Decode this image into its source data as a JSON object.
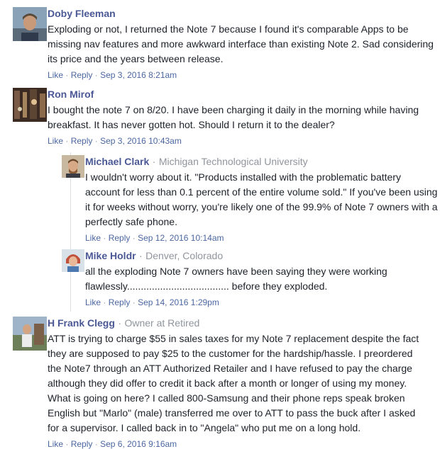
{
  "separator": "·",
  "comments": [
    {
      "author": "Doby Fleeman",
      "affiliation": "",
      "text": "Exploding or not, I returned the Note 7 because I found it's comparable Apps to be missing nav features and more awkward interface than existing Note 2. Sad considering its price and the years between release.",
      "like": "Like",
      "reply": "Reply",
      "date": "Sep 3, 2016 8:21am"
    },
    {
      "author": "Ron Mirof",
      "affiliation": "",
      "text": "I bought the note 7 on 8/20. I have been charging it daily in the morning while having breakfast. It has never gotten hot. Should I return it to the dealer?",
      "like": "Like",
      "reply": "Reply",
      "date": "Sep 3, 2016 10:43am",
      "replies": [
        {
          "author": "Michael Clark",
          "affiliation": "Michigan Technological University",
          "text": "I wouldn't worry about it. \"Products installed with the problematic battery account for less than 0.1 percent of the entire volume sold.\" If you've been using it for weeks without worry, you're likely one of the 99.9% of Note 7 owners with a perfectly safe phone.",
          "like": "Like",
          "reply": "Reply",
          "date": "Sep 12, 2016 10:14am"
        },
        {
          "author": "Mike Holdr",
          "affiliation": "Denver, Colorado",
          "text": "all the exploding Note 7 owners have been saying they were working flawlessly..................................... before they exploded.",
          "like": "Like",
          "reply": "Reply",
          "date": "Sep 14, 2016 1:29pm"
        }
      ]
    },
    {
      "author": "H Frank Clegg",
      "affiliation": "Owner at Retired",
      "text": "ATT is trying to charge $55 in sales taxes for my Note 7 replacement despite the fact they are supposed to pay $25 to the customer for the hardship/hassle. I preordered the Note7 through an ATT Authorized Retailer and I have refused to pay the charge although they did offer to credit it back after a month or longer of using my money. What is going on here? I called 800-Samsung and their phone reps speak broken English but \"Marlo\" (male) transferred me over to ATT to pass the buck after I asked for a supervisor. I called back in to \"Angela\" who put me on a long hold.",
      "like": "Like",
      "reply": "Reply",
      "date": "Sep 6, 2016 9:16am"
    }
  ]
}
